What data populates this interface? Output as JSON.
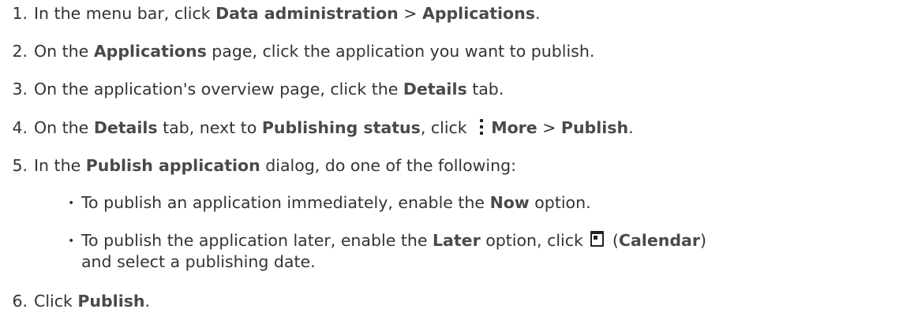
{
  "steps": [
    {
      "num": "1.",
      "t1": "In the menu bar, click ",
      "b1": "Data administration",
      "t2": " > ",
      "b2": "Applications",
      "t3": "."
    },
    {
      "num": "2.",
      "t1": "On the ",
      "b1": "Applications",
      "t2": " page, click the application you want to publish."
    },
    {
      "num": "3.",
      "t1": "On the application's overview page, click the ",
      "b1": "Details",
      "t2": " tab."
    },
    {
      "num": "4.",
      "t1": "On the ",
      "b1": "Details",
      "t2": " tab, next to ",
      "b2": "Publishing status",
      "t3": ", click ",
      "b3": "More",
      "t4": " > ",
      "b4": "Publish",
      "t5": "."
    },
    {
      "num": "5.",
      "t1": "In the ",
      "b1": "Publish application",
      "t2": " dialog, do one of the following:"
    },
    {
      "num": "6.",
      "t1": "Click ",
      "b1": "Publish",
      "t2": "."
    }
  ],
  "bullets": [
    {
      "t1": "To publish an application immediately, enable the ",
      "b1": "Now",
      "t2": " option."
    },
    {
      "t1": "To publish the application later, enable the ",
      "b1": "Later",
      "t2": " option, click ",
      "t3": " (",
      "b2": "Calendar",
      "t4": ")",
      "t5": "and select a publishing date."
    }
  ],
  "bullet_glyph": "•",
  "icons": [
    "more-vertical-icon",
    "calendar-icon"
  ]
}
